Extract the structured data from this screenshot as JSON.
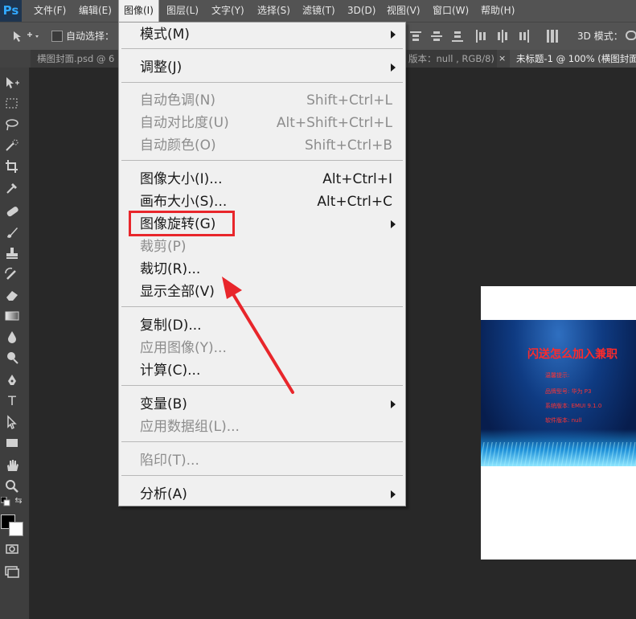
{
  "app": {
    "logo": "Ps"
  },
  "menubar": {
    "items": [
      "文件(F)",
      "编辑(E)",
      "图像(I)",
      "图层(L)",
      "文字(Y)",
      "选择(S)",
      "滤镜(T)",
      "3D(D)",
      "视图(V)",
      "窗口(W)",
      "帮助(H)"
    ]
  },
  "options_bar": {
    "auto_select_label": "自动选择：",
    "mode_3d_label": "3D 模式："
  },
  "tabs": [
    {
      "label": "横图封面.psd @ 6"
    },
    {
      "label": "版本：null , RGB/8)",
      "close": "×"
    },
    {
      "label": "未标题-1 @ 100% (横图封面"
    }
  ],
  "dropdown": {
    "items": [
      {
        "label": "模式(M)",
        "submenu": true
      },
      {
        "label": "调整(J)",
        "submenu": true
      },
      {
        "label": "自动色调(N)",
        "shortcut": "Shift+Ctrl+L",
        "disabled": true
      },
      {
        "label": "自动对比度(U)",
        "shortcut": "Alt+Shift+Ctrl+L",
        "disabled": true
      },
      {
        "label": "自动颜色(O)",
        "shortcut": "Shift+Ctrl+B",
        "disabled": true
      },
      {
        "label": "图像大小(I)...",
        "shortcut": "Alt+Ctrl+I"
      },
      {
        "label": "画布大小(S)...",
        "shortcut": "Alt+Ctrl+C"
      },
      {
        "label": "图像旋转(G)",
        "submenu": true,
        "highlighted": true
      },
      {
        "label": "裁剪(P)",
        "disabled": true
      },
      {
        "label": "裁切(R)..."
      },
      {
        "label": "显示全部(V)"
      },
      {
        "label": "复制(D)..."
      },
      {
        "label": "应用图像(Y)...",
        "disabled": true
      },
      {
        "label": "计算(C)..."
      },
      {
        "label": "变量(B)",
        "submenu": true
      },
      {
        "label": "应用数据组(L)...",
        "disabled": true
      },
      {
        "label": "陷印(T)...",
        "disabled": true
      },
      {
        "label": "分析(A)",
        "submenu": true
      }
    ]
  },
  "document": {
    "title": "闪送怎么加入兼职",
    "lines": [
      "温馨提示:",
      "品牌型号: 华为 P3",
      "系统版本: EMUI 9.1.0",
      "软件版本: null"
    ]
  },
  "colors": {
    "highlight": "#e8262b",
    "menubar_bg": "#535353",
    "menu_bg": "#f0f0f0",
    "workspace_bg": "#282828"
  }
}
